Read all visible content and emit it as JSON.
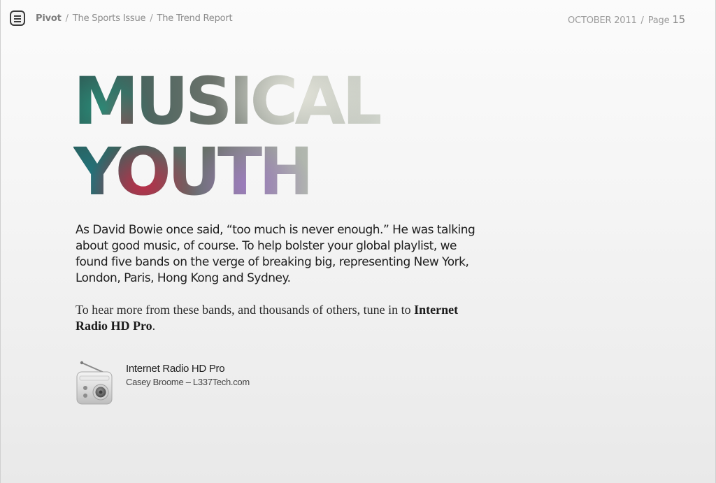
{
  "header": {
    "menu_icon": "menu-icon",
    "breadcrumb": {
      "app": "Pivot",
      "separator": "/",
      "issue": "The Sports Issue",
      "section": "The Trend Report"
    },
    "issue_date": "OCTOBER 2011",
    "page_label": "Page",
    "page_number": "15"
  },
  "article": {
    "title_line1": "MUSICAL",
    "title_line2": "YOUTH",
    "intro": "As David Bowie once said, “too much is never enough.”  He was talking about good music, of course.  To help bolster your global playlist, we found five bands on the verge of breaking big, representing New York, London, Paris, Hong Kong and Sydney.",
    "promo_prefix": "To hear more from these bands, and thousands of others, tune in to",
    "promo_app": "Internet Radio HD Pro",
    "promo_suffix": "."
  },
  "app_card": {
    "icon": "radio-icon",
    "name": "Internet Radio HD Pro",
    "developer": "Casey Broome – L337Tech.com"
  }
}
